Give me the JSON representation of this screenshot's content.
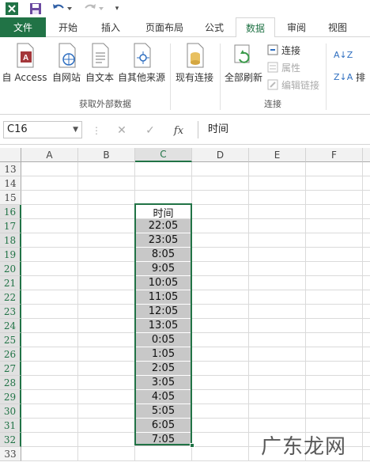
{
  "quick_access": {
    "undo_icon": "undo-icon",
    "redo_icon": "redo-icon"
  },
  "tabs": [
    {
      "label": "文件"
    },
    {
      "label": "开始"
    },
    {
      "label": "插入"
    },
    {
      "label": "页面布局"
    },
    {
      "label": "公式"
    },
    {
      "label": "数据"
    },
    {
      "label": "审阅"
    },
    {
      "label": "视图"
    }
  ],
  "active_tab": "数据",
  "ribbon": {
    "get_external_data": {
      "group_label": "获取外部数据",
      "from_access": "自 Access",
      "from_web": "自网站",
      "from_text": "自文本",
      "from_other": "自其他来源",
      "existing_connections": "现有连接"
    },
    "connections": {
      "group_label": "连接",
      "refresh_all": "全部刷新",
      "connections": "连接",
      "properties": "属性",
      "edit_links": "编辑链接"
    },
    "sort": {
      "label": "排"
    }
  },
  "formula_bar": {
    "name_box": "C16",
    "formula": "时间",
    "fx": "fx"
  },
  "columns": [
    "A",
    "B",
    "C",
    "D",
    "E",
    "F"
  ],
  "selected_column": "C",
  "rows": [
    "13",
    "14",
    "15",
    "16",
    "17",
    "18",
    "19",
    "20",
    "21",
    "22",
    "23",
    "24",
    "25",
    "26",
    "27",
    "28",
    "29",
    "30",
    "31",
    "32",
    "33"
  ],
  "cells": [
    "时间",
    "22:05",
    "23:05",
    "8:05",
    "9:05",
    "10:05",
    "11:05",
    "12:05",
    "13:05",
    "0:05",
    "1:05",
    "2:05",
    "3:05",
    "4:05",
    "5:05",
    "6:05",
    "7:05"
  ],
  "watermark": "广东龙网",
  "colors": {
    "accent": "#217346",
    "selection_fill": "#c8c8c8"
  }
}
